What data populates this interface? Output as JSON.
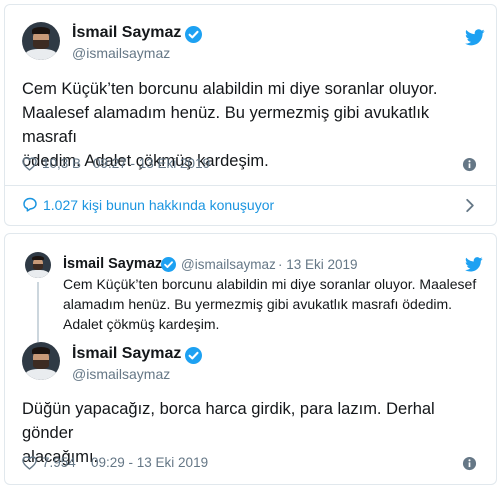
{
  "tweet1": {
    "author_name": "İsmail Saymaz",
    "author_handle": "@ismailsaymaz",
    "text_lines": [
      "Cem Küçük’ten borcunu alabildin mi diye soranlar oluyor.",
      "Maalesef alamadım henüz. Bu yermezmiş gibi avukatlık masrafı",
      "ödedim. Adalet çökmüş kardeşim."
    ],
    "likes": "10,3 B",
    "timestamp": "09:27 - 13 Eki 2019",
    "conversation": "1.027 kişi bunun hakkında konuşuyor"
  },
  "tweet2": {
    "quoted": {
      "author_name": "İsmail Saymaz",
      "author_handle": "@ismailsaymaz",
      "date": "· 13 Eki 2019",
      "text_lines": [
        "Cem Küçük’ten borcunu alabildin mi diye soranlar oluyor. Maalesef",
        "alamadım henüz. Bu yermezmiş gibi avukatlık masrafı ödedim.",
        "Adalet çökmüş kardeşim."
      ]
    },
    "author_name": "İsmail Saymaz",
    "author_handle": "@ismailsaymaz",
    "text_lines": [
      "Düğün yapacağız, borca harca girdik, para lazım. Derhal gönder",
      "alacağımı."
    ],
    "likes": "7.954",
    "timestamp": "09:29 - 13 Eki 2019"
  },
  "icons": {
    "verified": "verified-badge-icon",
    "bird": "twitter-bird-icon",
    "heart": "heart-icon",
    "info": "info-icon",
    "reply": "reply-bubble-icon",
    "chevron": "chevron-right-icon"
  },
  "colors": {
    "brand_blue": "#1da1f2",
    "link_blue": "#1b95e0",
    "secondary_text": "#657786",
    "border": "#e1e8ed"
  }
}
